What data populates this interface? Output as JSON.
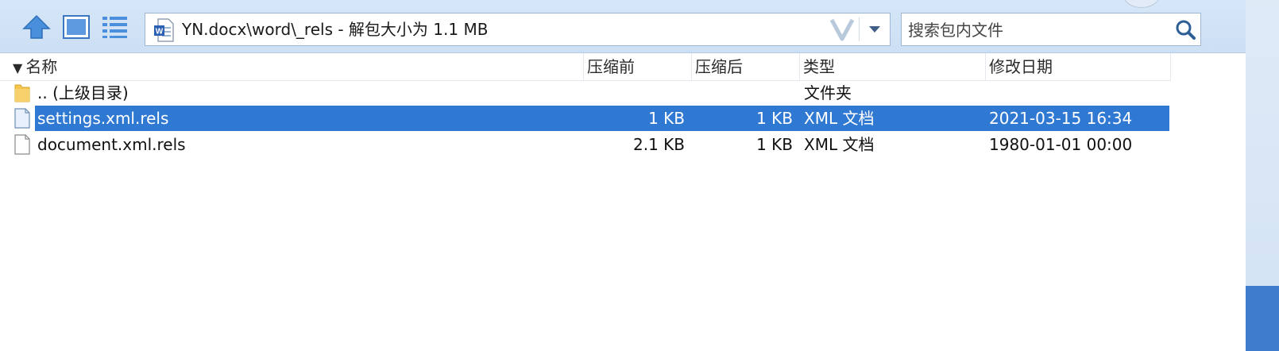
{
  "toolbar": {
    "up_icon": "arrow-up-icon",
    "view_icon": "thumbnail-view-icon",
    "list_icon": "list-view-icon"
  },
  "address": {
    "icon": "word-document-icon",
    "text": "YN.docx\\word\\_rels - 解包大小为 1.1 MB",
    "history_icon": "v-history-icon",
    "dropdown_icon": "chevron-down-icon"
  },
  "search": {
    "placeholder": "搜索包内文件",
    "icon": "search-icon"
  },
  "columns": {
    "name": "名称",
    "before": "压缩前",
    "after": "压缩后",
    "type": "类型",
    "date": "修改日期"
  },
  "rows": [
    {
      "icon": "folder-icon",
      "name": ".. (上级目录)",
      "before": "",
      "after": "",
      "type": "文件夹",
      "date": "",
      "selected": false
    },
    {
      "icon": "file-icon",
      "name": "settings.xml.rels",
      "before": "1 KB",
      "after": "1 KB",
      "type": "XML 文档",
      "date": "2021-03-15 16:34",
      "selected": true
    },
    {
      "icon": "file-icon",
      "name": "document.xml.rels",
      "before": "2.1 KB",
      "after": "1 KB",
      "type": "XML 文档",
      "date": "1980-01-01 00:00",
      "selected": false
    }
  ],
  "colors": {
    "selection": "#3079d3",
    "toolbar_bg": "#d5e6f8",
    "accent_blue": "#3d7bcc"
  }
}
